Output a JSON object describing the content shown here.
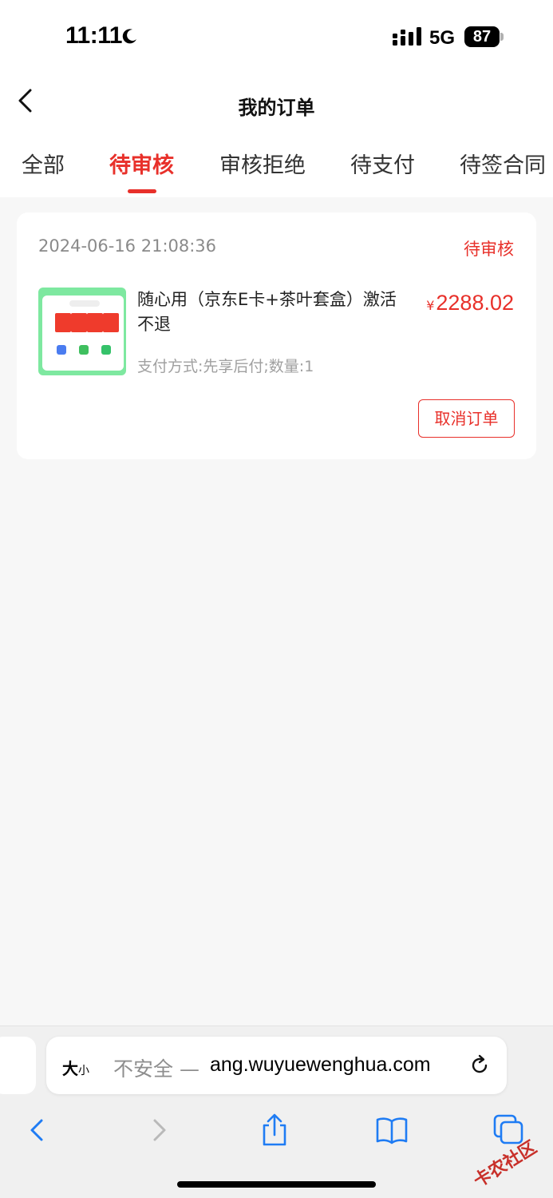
{
  "status_bar": {
    "time": "11:11",
    "network": "5G",
    "battery": "87"
  },
  "header": {
    "title": "我的订单"
  },
  "tabs": [
    {
      "label": "全部"
    },
    {
      "label": "待审核"
    },
    {
      "label": "审核拒绝"
    },
    {
      "label": "待支付"
    },
    {
      "label": "待签合同"
    }
  ],
  "order": {
    "datetime": "2024-06-16 21:08:36",
    "status": "待审核",
    "product_name": "随心用（京东E卡+茶叶套盒）激活不退",
    "price_symbol": "¥",
    "price": "2288.02",
    "meta": "支付方式:先享后付;数量:1",
    "cancel_label": "取消订单"
  },
  "browser": {
    "text_size_big": "大",
    "text_size_small": "小",
    "url_insecure": "不安全 —",
    "url_domain": "ang.wuyuewenghua.com"
  },
  "watermark": "卡农社区",
  "colors": {
    "accent": "#e8302a",
    "ios_blue": "#1f7cf4"
  }
}
